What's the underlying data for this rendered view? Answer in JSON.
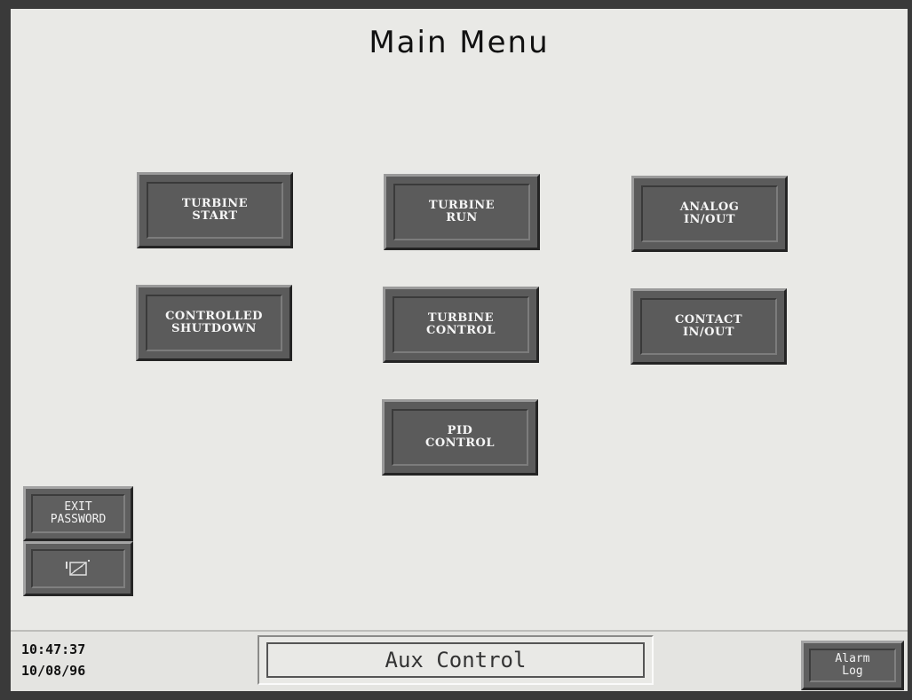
{
  "screen": {
    "title": "Main Menu"
  },
  "menu": {
    "turbine_start": "TURBINE\nSTART",
    "turbine_run": "TURBINE\nRUN",
    "analog_io": "ANALOG\nIN/OUT",
    "controlled_shutdown": "CONTROLLED\nSHUTDOWN",
    "turbine_control": "TURBINE\nCONTROL",
    "contact_io": "CONTACT\nIN/OUT",
    "pid_control": "PID\nCONTROL"
  },
  "side": {
    "exit_password": "EXIT\nPASSWORD",
    "screen_icon": "screen-off-icon"
  },
  "status": {
    "time": "10:47:37",
    "date": "10/08/96",
    "screen_name": "Aux Control",
    "alarm_log": "Alarm\nLog"
  },
  "colors": {
    "background": "#e9e9e6",
    "button_face": "#5b5b5b",
    "button_text": "#f6f6f6"
  }
}
